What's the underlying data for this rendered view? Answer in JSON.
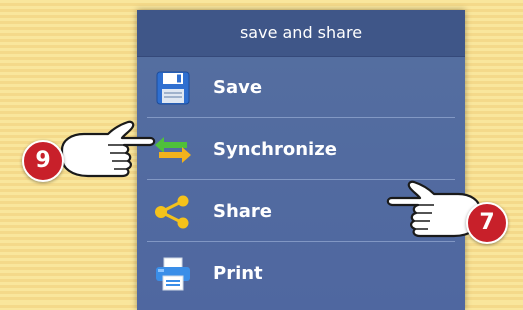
{
  "menu": {
    "header": "save and share",
    "items": [
      {
        "label": "Save",
        "icon": "floppy-disk-icon"
      },
      {
        "label": "Synchronize",
        "icon": "sync-arrows-icon"
      },
      {
        "label": "Share",
        "icon": "share-icon"
      },
      {
        "label": "Print",
        "icon": "printer-icon"
      }
    ]
  },
  "callouts": {
    "left": {
      "number": "9",
      "icon": "pointing-hand-right-icon"
    },
    "right": {
      "number": "7",
      "icon": "pointing-hand-left-icon"
    }
  },
  "colors": {
    "background": "#f7e08f",
    "panel": "#4f67a0",
    "header": "#3f5688",
    "badge": "#c8202a"
  }
}
